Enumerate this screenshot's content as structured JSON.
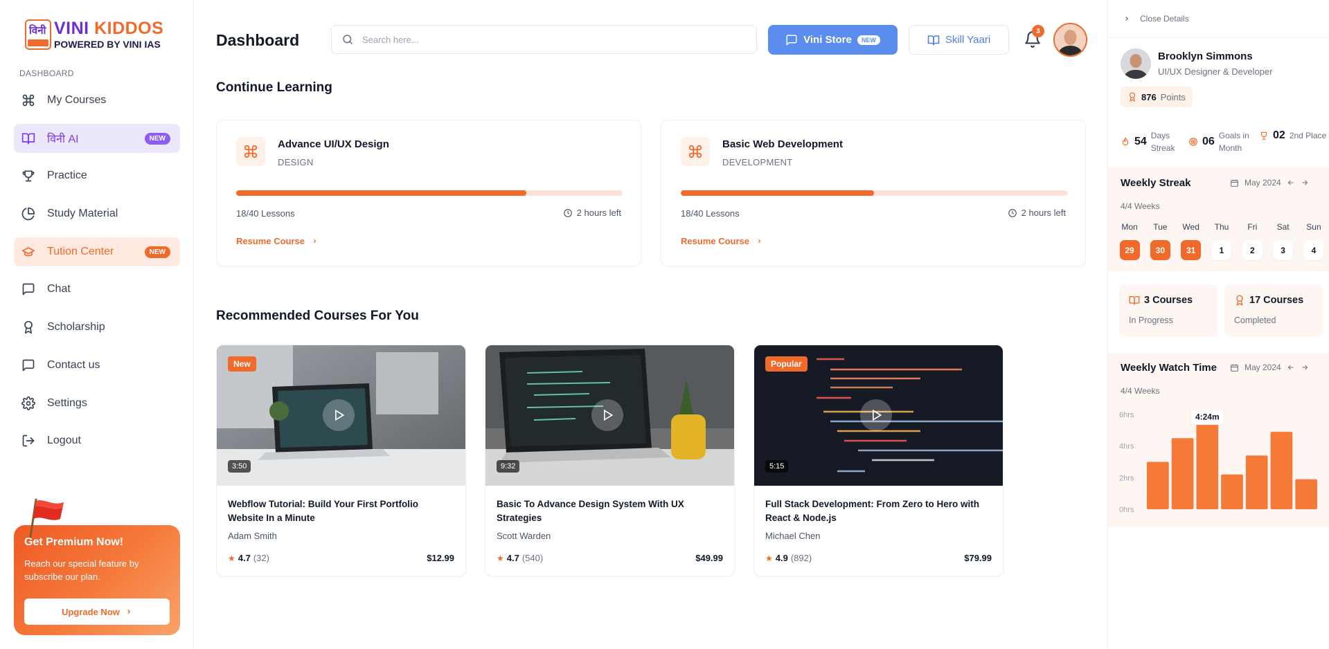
{
  "brand": {
    "mark_text": "विनी",
    "name_first": "VINI",
    "name_second": "KIDDOS",
    "powered_prefix": "POWERED BY",
    "powered_brand": "VINI IAS"
  },
  "sidebar": {
    "section": "DASHBOARD",
    "items": [
      {
        "label": "My Courses",
        "icon": "command-icon"
      },
      {
        "label": "विनी AI",
        "icon": "book-open-icon",
        "badge": "NEW"
      },
      {
        "label": "Practice",
        "icon": "trophy-icon"
      },
      {
        "label": "Study Material",
        "icon": "pie-chart-icon"
      },
      {
        "label": "Tution Center",
        "icon": "graduation-cap-icon",
        "badge": "NEW"
      },
      {
        "label": "Chat",
        "icon": "message-square-icon"
      },
      {
        "label": "Scholarship",
        "icon": "award-icon"
      },
      {
        "label": "Contact us",
        "icon": "message-square-icon"
      },
      {
        "label": "Settings",
        "icon": "gear-icon"
      },
      {
        "label": "Logout",
        "icon": "logout-icon"
      }
    ],
    "premium": {
      "title": "Get Premium Now!",
      "text": "Reach our special feature by subscribe our plan.",
      "button": "Upgrade Now"
    }
  },
  "header": {
    "title": "Dashboard",
    "search_placeholder": "Search here...",
    "store_label": "Vini Store",
    "store_badge": "NEW",
    "yaari_label": "Skill Yaari",
    "notification_count": "3"
  },
  "continue": {
    "title": "Continue Learning",
    "courses": [
      {
        "title": "Advance UI/UX Design",
        "category": "DESIGN",
        "progress": 0.75,
        "lessons": "18/40 Lessons",
        "time_left": "2 hours left",
        "action": "Resume Course"
      },
      {
        "title": "Basic Web Development",
        "category": "DEVELOPMENT",
        "progress": 0.5,
        "lessons": "18/40 Lessons",
        "time_left": "2 hours left",
        "action": "Resume Course"
      }
    ]
  },
  "recommended": {
    "title": "Recommended Courses For You",
    "courses": [
      {
        "tag": "New",
        "duration": "3:50",
        "title": "Webflow Tutorial: Build Your First Portfolio Website In a Minute",
        "author": "Adam Smith",
        "rating": "4.7",
        "reviews": "(32)",
        "price": "$12.99"
      },
      {
        "tag": "",
        "duration": "9:32",
        "title": "Basic To Advance Design System With UX Strategies",
        "author": "Scott Warden",
        "rating": "4.7",
        "reviews": "(540)",
        "price": "$49.99"
      },
      {
        "tag": "Popular",
        "duration": "5:15",
        "title": "Full Stack Development: From Zero to Hero with React & Node.js",
        "author": "Michael Chen",
        "rating": "4.9",
        "reviews": "(892)",
        "price": "$79.99"
      }
    ]
  },
  "details": {
    "close_label": "Close Details",
    "name": "Brooklyn Simmons",
    "role": "UI/UX Designer & Developer",
    "points_value": "876",
    "points_label": "Points",
    "stats": [
      {
        "value": "54",
        "label": "Days Streak",
        "icon": "flame-icon"
      },
      {
        "value": "06",
        "label": "Goals in Month",
        "icon": "target-icon"
      },
      {
        "value": "02",
        "label": "2nd Place",
        "icon": "trophy-icon"
      }
    ],
    "streak": {
      "title": "Weekly Streak",
      "month": "May 2024",
      "sub": "4/4 Weeks",
      "days": [
        {
          "name": "Mon",
          "num": "29",
          "done": true
        },
        {
          "name": "Tue",
          "num": "30",
          "done": true
        },
        {
          "name": "Wed",
          "num": "31",
          "done": true
        },
        {
          "name": "Thu",
          "num": "1",
          "done": false
        },
        {
          "name": "Fri",
          "num": "2",
          "done": false
        },
        {
          "name": "Sat",
          "num": "3",
          "done": false
        },
        {
          "name": "Sun",
          "num": "4",
          "done": false
        }
      ]
    },
    "summary": [
      {
        "value": "3 Courses",
        "label": "In Progress",
        "icon": "book-open-icon"
      },
      {
        "value": "17 Courses",
        "label": "Completed",
        "icon": "award-icon"
      }
    ],
    "watch": {
      "title": "Weekly Watch Time",
      "month": "May 2024",
      "sub": "4/4 Weeks",
      "tooltip": "4:24m"
    }
  },
  "chart_data": {
    "type": "bar",
    "categories": [
      "Mon",
      "Tue",
      "Wed",
      "Thu",
      "Fri",
      "Sat",
      "Sun"
    ],
    "values": [
      3.0,
      4.5,
      5.8,
      2.2,
      3.4,
      4.9,
      1.9
    ],
    "yticks": [
      "6hrs",
      "4hrs",
      "2hrs",
      "0hrs"
    ],
    "ylim": [
      0,
      6
    ],
    "highlight_index": 2,
    "color": "#f57a38"
  },
  "colors": {
    "accent": "#f06a2b",
    "ai": "#7c3aed",
    "store": "#5b8def"
  }
}
